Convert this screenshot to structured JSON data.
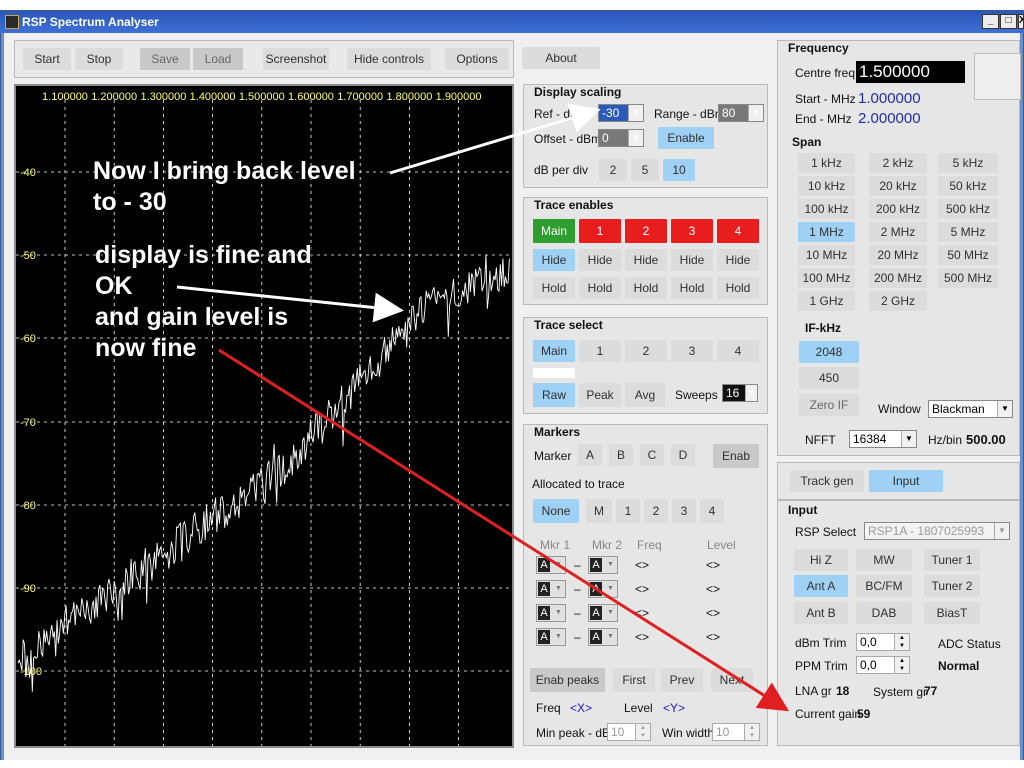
{
  "window": {
    "title": "RSP Spectrum Analyser",
    "minimize": "_",
    "maximize": "□",
    "close": "X"
  },
  "toolbar": {
    "start": "Start",
    "stop": "Stop",
    "save": "Save",
    "load": "Load",
    "screenshot": "Screenshot",
    "hide_controls": "Hide controls",
    "options": "Options",
    "about": "About"
  },
  "plot": {
    "x_ticks": [
      "1.100000",
      "1.200000",
      "1.300000",
      "1.400000",
      "1.500000",
      "1.600000",
      "1.700000",
      "1.800000",
      "1.900000"
    ],
    "y_ticks": [
      "-40",
      "-50",
      "-60",
      "-70",
      "-80",
      "-90",
      "-100"
    ],
    "trace_color": "#ffffff",
    "grid_color": "#ffffff",
    "label_color": "#ffff66"
  },
  "annotations": {
    "line1a": "Now I bring back level",
    "line1b": "to - 30",
    "line2a": "display is fine and",
    "line2b": "OK",
    "line3a": "and gain level is",
    "line3b": "now fine",
    "arrow_red": "#e02020",
    "arrow_white": "#ffffff"
  },
  "display_scaling": {
    "title": "Display scaling",
    "ref_label": "Ref - dBm",
    "ref_value": "-30",
    "range_label": "Range - dBm",
    "range_value": "80",
    "offset_label": "Offset - dBm",
    "offset_value": "0",
    "enable": "Enable",
    "dbdiv_label": "dB per div",
    "dbdiv": [
      "2",
      "5",
      "10"
    ]
  },
  "trace_enables": {
    "title": "Trace enables",
    "traces": [
      "Main",
      "1",
      "2",
      "3",
      "4"
    ],
    "hide": "Hide",
    "hold": "Hold"
  },
  "trace_select": {
    "title": "Trace select",
    "traces": [
      "Main",
      "1",
      "2",
      "3",
      "4"
    ],
    "raw": "Raw",
    "peak": "Peak",
    "avg": "Avg",
    "sweeps_label": "Sweeps",
    "sweeps_value": "16"
  },
  "markers": {
    "title": "Markers",
    "marker_label": "Marker",
    "markers": [
      "A",
      "B",
      "C",
      "D"
    ],
    "enab": "Enab",
    "allocated_label": "Allocated to trace",
    "alloc": [
      "None",
      "M",
      "1",
      "2",
      "3",
      "4"
    ],
    "mkr1": "Mkr 1",
    "mkr2": "Mkr 2",
    "freq": "Freq",
    "level": "Level",
    "row_a": "A",
    "dash": "–",
    "empty": "<>",
    "enab_peaks": "Enab peaks",
    "first": "First",
    "prev": "Prev",
    "next": "Next",
    "freq_label": "Freq",
    "freq_val": "<X>",
    "level_label": "Level",
    "level_val": "<Y>",
    "min_peak_label": "Min peak - dB",
    "min_peak_val": "10",
    "win_width_label": "Win width",
    "win_width_val": "10"
  },
  "frequency": {
    "title": "Frequency",
    "centre_label": "Centre freq",
    "centre_value": "1.500000",
    "start_label": "Start - MHz",
    "start_value": "1.000000",
    "end_label": "End - MHz",
    "end_value": "2.000000",
    "span_title": "Span",
    "spans": [
      "1 kHz",
      "2 kHz",
      "5 kHz",
      "10 kHz",
      "20 kHz",
      "50 kHz",
      "100 kHz",
      "200 kHz",
      "500 kHz",
      "1 MHz",
      "2 MHz",
      "5 MHz",
      "10 MHz",
      "20 MHz",
      "50 MHz",
      "100 MHz",
      "200 MHz",
      "500 MHz",
      "1 GHz",
      "2 GHz"
    ],
    "if_title": "IF-kHz",
    "if_2048": "2048",
    "if_450": "450",
    "zero_if": "Zero IF",
    "window_label": "Window",
    "window_value": "Blackman",
    "nfft_label": "NFFT",
    "nfft_value": "16384",
    "hzbin_label": "Hz/bin",
    "hzbin_value": "500.00"
  },
  "lower_tabs": {
    "track_gen": "Track gen",
    "input": "Input"
  },
  "input": {
    "title": "Input",
    "rsp_label": "RSP Select",
    "rsp_value": "RSP1A - 1807025993",
    "hiz": "Hi Z",
    "mw": "MW",
    "tuner1": "Tuner 1",
    "anta": "Ant A",
    "bcfm": "BC/FM",
    "tuner2": "Tuner 2",
    "antb": "Ant B",
    "dab": "DAB",
    "biast": "BiasT",
    "dbm_trim_label": "dBm Trim",
    "dbm_trim_value": "0,0",
    "ppm_trim_label": "PPM Trim",
    "ppm_trim_value": "0,0",
    "adc_label": "ADC Status",
    "adc_value": "Normal",
    "lna_label": "LNA gr",
    "lna_value": "18",
    "sys_label": "System gr",
    "sys_value": "77",
    "cur_label": "Current gain",
    "cur_value": "59"
  }
}
